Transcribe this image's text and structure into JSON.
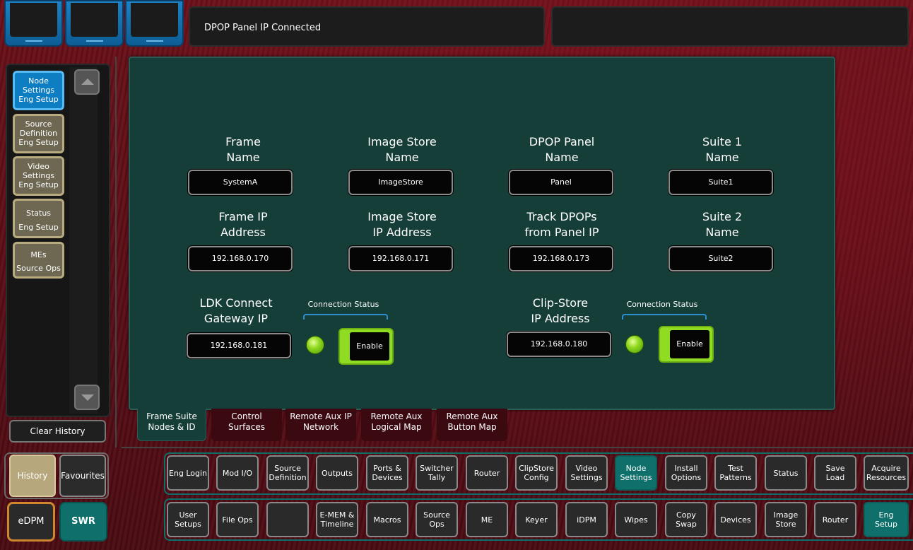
{
  "status": {
    "message": "DPOP Panel IP Connected",
    "secondary_message": ""
  },
  "sidebar": {
    "items": [
      {
        "label": "Node\nSettings",
        "sub": "Eng Setup",
        "active": true
      },
      {
        "label": "Source\nDefinition",
        "sub": "Eng Setup",
        "active": false
      },
      {
        "label": "Video\nSettings",
        "sub": "Eng Setup",
        "active": false
      },
      {
        "label": "Status",
        "sub": "Eng Setup",
        "active": false
      },
      {
        "label": "MEs",
        "sub": "Source Ops",
        "active": false
      }
    ],
    "clear_history": "Clear History",
    "history": "History",
    "favourites": "Favourites",
    "edpm": "eDPM",
    "swr": "SWR"
  },
  "panel": {
    "frame_name": {
      "title1": "Frame",
      "title2": "Name",
      "value": "SystemA"
    },
    "image_store_name": {
      "title1": "Image Store",
      "title2": "Name",
      "value": "ImageStore"
    },
    "dpop_panel_name": {
      "title1": "DPOP Panel",
      "title2": "Name",
      "value": "Panel"
    },
    "suite1_name": {
      "title1": "Suite 1",
      "title2": "Name",
      "value": "Suite1"
    },
    "frame_ip": {
      "title1": "Frame IP",
      "title2": "Address",
      "value": "192.168.0.170"
    },
    "image_store_ip": {
      "title1": "Image Store",
      "title2": "IP Address",
      "value": "192.168.0.171"
    },
    "track_dpops": {
      "title1": "Track DPOPs",
      "title2": "from Panel IP",
      "value": "192.168.0.173"
    },
    "suite2_name": {
      "title1": "Suite 2",
      "title2": "Name",
      "value": "Suite2"
    },
    "ldk_gateway": {
      "title1": "LDK Connect",
      "title2": "Gateway IP",
      "value": "192.168.0.181"
    },
    "clip_store_ip": {
      "title1": "Clip-Store",
      "title2": "IP Address",
      "value": "192.168.0.180"
    },
    "connection_status_label": "Connection Status",
    "enable_label": "Enable"
  },
  "page_tabs": [
    {
      "line1": "Frame Suite",
      "line2": "Nodes & ID",
      "active": true
    },
    {
      "line1": "Control",
      "line2": "Surfaces",
      "active": false
    },
    {
      "line1": "Remote Aux IP",
      "line2": "Network",
      "active": false
    },
    {
      "line1": "Remote Aux",
      "line2": "Logical Map",
      "active": false
    },
    {
      "line1": "Remote Aux",
      "line2": "Button Map",
      "active": false
    }
  ],
  "eng_row": [
    {
      "label": "Eng Login"
    },
    {
      "label": "Mod I/O"
    },
    {
      "label": "Source\nDefinition"
    },
    {
      "label": "Outputs"
    },
    {
      "label": "Ports &\nDevices"
    },
    {
      "label": "Switcher\nTally"
    },
    {
      "label": "Router"
    },
    {
      "label": "ClipStore\nConfig"
    },
    {
      "label": "Video\nSettings"
    },
    {
      "label": "Node\nSettings",
      "active": true
    },
    {
      "label": "Install\nOptions"
    },
    {
      "label": "Test\nPatterns"
    },
    {
      "label": "Status"
    },
    {
      "label": "Save Load"
    },
    {
      "label": "Acquire\nResources"
    }
  ],
  "main_row": [
    {
      "label": "User\nSetups"
    },
    {
      "label": "File Ops"
    },
    {
      "label": ""
    },
    {
      "label": "E-MEM &\nTimeline"
    },
    {
      "label": "Macros"
    },
    {
      "label": "Source\nOps"
    },
    {
      "label": "ME"
    },
    {
      "label": "Keyer"
    },
    {
      "label": "iDPM"
    },
    {
      "label": "Wipes"
    },
    {
      "label": "Copy\nSwap"
    },
    {
      "label": "Devices"
    },
    {
      "label": "Image\nStore"
    },
    {
      "label": "Router"
    },
    {
      "label": "Eng\nSetup",
      "active": true
    }
  ],
  "colors": {
    "accent_blue": "#0e7ec3",
    "panel_green": "#163e39",
    "active_teal": "#0f6f6a",
    "led_green": "#8fd81e",
    "edpm_orange": "#d0862e"
  }
}
